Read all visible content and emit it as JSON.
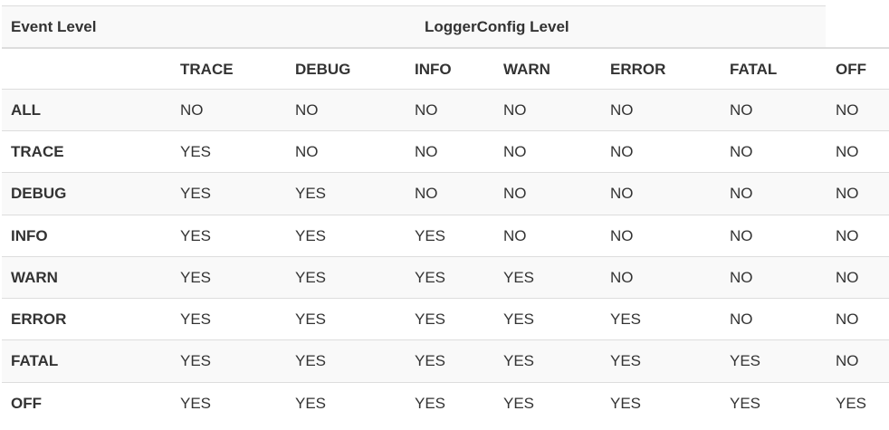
{
  "header": {
    "event_level_label": "Event Level",
    "logger_config_label": "LoggerConfig Level"
  },
  "columns": [
    "TRACE",
    "DEBUG",
    "INFO",
    "WARN",
    "ERROR",
    "FATAL",
    "OFF"
  ],
  "rows": [
    {
      "level": "ALL",
      "values": [
        "NO",
        "NO",
        "NO",
        "NO",
        "NO",
        "NO",
        "NO"
      ]
    },
    {
      "level": "TRACE",
      "values": [
        "YES",
        "NO",
        "NO",
        "NO",
        "NO",
        "NO",
        "NO"
      ]
    },
    {
      "level": "DEBUG",
      "values": [
        "YES",
        "YES",
        "NO",
        "NO",
        "NO",
        "NO",
        "NO"
      ]
    },
    {
      "level": "INFO",
      "values": [
        "YES",
        "YES",
        "YES",
        "NO",
        "NO",
        "NO",
        "NO"
      ]
    },
    {
      "level": "WARN",
      "values": [
        "YES",
        "YES",
        "YES",
        "YES",
        "NO",
        "NO",
        "NO"
      ]
    },
    {
      "level": "ERROR",
      "values": [
        "YES",
        "YES",
        "YES",
        "YES",
        "YES",
        "NO",
        "NO"
      ]
    },
    {
      "level": "FATAL",
      "values": [
        "YES",
        "YES",
        "YES",
        "YES",
        "YES",
        "YES",
        "NO"
      ]
    },
    {
      "level": "OFF",
      "values": [
        "YES",
        "YES",
        "YES",
        "YES",
        "YES",
        "YES",
        "YES"
      ]
    }
  ]
}
